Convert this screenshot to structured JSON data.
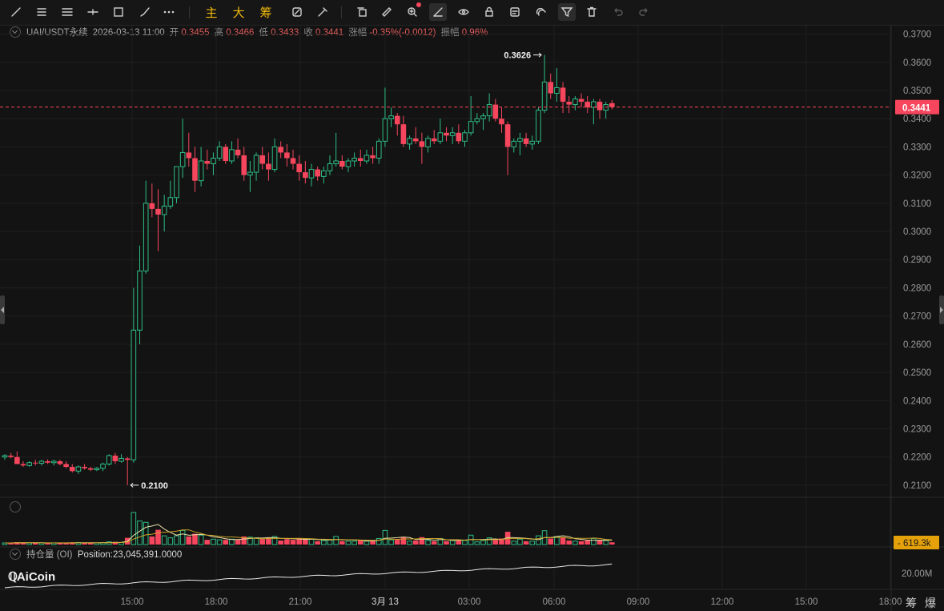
{
  "toolbar": {
    "text_buttons": [
      "主",
      "大",
      "筹"
    ],
    "icons": [
      "trend-line-icon",
      "parallel-lines-icon",
      "horizontal-lines-icon",
      "horizontal-ray-icon",
      "rectangle-icon",
      "brush-icon",
      "more-icon",
      "magnet-mode-icon",
      "pencil-edit-icon",
      "copy-icon",
      "ruler-icon",
      "zoom-icon",
      "draw-mode-icon",
      "hide-drawings-icon",
      "lock-icon",
      "drawing-template-icon",
      "magnet-icon",
      "filter-icon",
      "trash-icon",
      "undo-icon",
      "redo-icon"
    ]
  },
  "info": {
    "symbol": "UAI/USDT永续",
    "datetime": "2026-03-13 11:00",
    "open_label": "开",
    "open": "0.3455",
    "high_label": "高",
    "high": "0.3466",
    "low_label": "低",
    "low": "0.3433",
    "close_label": "收",
    "close": "0.3441",
    "change_label": "涨幅",
    "change": "-0.35%(-0.0012)",
    "amplitude_label": "振幅",
    "amplitude": "0.96%"
  },
  "price_axis": {
    "ticks": [
      "0.3700",
      "0.3600",
      "0.3500",
      "0.3400",
      "0.3300",
      "0.3200",
      "0.3100",
      "0.3000",
      "0.2900",
      "0.2800",
      "0.2700",
      "0.2600",
      "0.2500",
      "0.2400",
      "0.2300",
      "0.2200",
      "0.2100"
    ],
    "current_price": "0.3441",
    "max_marker": "0.3626",
    "min_marker": "0.2100"
  },
  "volume": {
    "last_label": "619.3k"
  },
  "open_interest": {
    "label": "持仓量 (OI)",
    "position": "Position:23,045,391.0000",
    "axis_label": "20.00M"
  },
  "time_axis": {
    "ticks": [
      "15:00",
      "18:00",
      "21:00",
      "3月 13",
      "03:00",
      "06:00",
      "09:00",
      "12:00",
      "15:00",
      "18:00"
    ]
  },
  "brand": {
    "name": "AiCoin"
  },
  "bottom_icons": [
    "筹",
    "爆"
  ],
  "colors": {
    "up": "#2ebd85",
    "down": "#f6465d",
    "accent": "#f0b90b"
  },
  "chart_data": {
    "type": "candlestick",
    "series": [
      {
        "name": "OHLC",
        "values": [
          [
            0.22,
            0.221,
            0.219,
            0.2205
          ],
          [
            0.2205,
            0.2215,
            0.2195,
            0.22
          ],
          [
            0.22,
            0.222,
            0.2185,
            0.2175
          ],
          [
            0.2175,
            0.2185,
            0.2165,
            0.217
          ],
          [
            0.217,
            0.2185,
            0.2165,
            0.218
          ],
          [
            0.218,
            0.219,
            0.217,
            0.2178
          ],
          [
            0.2178,
            0.219,
            0.217,
            0.2185
          ],
          [
            0.2185,
            0.2192,
            0.2175,
            0.218
          ],
          [
            0.218,
            0.219,
            0.217,
            0.2185
          ],
          [
            0.2185,
            0.219,
            0.217,
            0.2175
          ],
          [
            0.2175,
            0.2185,
            0.216,
            0.2165
          ],
          [
            0.2165,
            0.2175,
            0.2145,
            0.215
          ],
          [
            0.215,
            0.217,
            0.214,
            0.2165
          ],
          [
            0.2165,
            0.2175,
            0.2155,
            0.216
          ],
          [
            0.216,
            0.2165,
            0.215,
            0.2155
          ],
          [
            0.2155,
            0.2165,
            0.215,
            0.216
          ],
          [
            0.216,
            0.218,
            0.215,
            0.2175
          ],
          [
            0.2175,
            0.221,
            0.217,
            0.2205
          ],
          [
            0.2205,
            0.2215,
            0.2175,
            0.2185
          ],
          [
            0.2185,
            0.221,
            0.218,
            0.2195
          ],
          [
            0.2195,
            0.22,
            0.21,
            0.219
          ],
          [
            0.219,
            0.28,
            0.218,
            0.265
          ],
          [
            0.265,
            0.295,
            0.26,
            0.286
          ],
          [
            0.286,
            0.318,
            0.285,
            0.31
          ],
          [
            0.31,
            0.317,
            0.305,
            0.308
          ],
          [
            0.308,
            0.315,
            0.293,
            0.306
          ],
          [
            0.306,
            0.313,
            0.3,
            0.309
          ],
          [
            0.309,
            0.318,
            0.308,
            0.312
          ],
          [
            0.312,
            0.323,
            0.31,
            0.323
          ],
          [
            0.323,
            0.34,
            0.319,
            0.328
          ],
          [
            0.328,
            0.335,
            0.323,
            0.326
          ],
          [
            0.326,
            0.33,
            0.314,
            0.318
          ],
          [
            0.318,
            0.33,
            0.316,
            0.325
          ],
          [
            0.325,
            0.329,
            0.322,
            0.324
          ],
          [
            0.324,
            0.328,
            0.32,
            0.326
          ],
          [
            0.326,
            0.332,
            0.325,
            0.33
          ],
          [
            0.33,
            0.331,
            0.324,
            0.325
          ],
          [
            0.325,
            0.332,
            0.324,
            0.329
          ],
          [
            0.329,
            0.333,
            0.326,
            0.327
          ],
          [
            0.327,
            0.33,
            0.318,
            0.32
          ],
          [
            0.32,
            0.325,
            0.314,
            0.321
          ],
          [
            0.321,
            0.328,
            0.318,
            0.327
          ],
          [
            0.327,
            0.33,
            0.322,
            0.324
          ],
          [
            0.324,
            0.328,
            0.318,
            0.322
          ],
          [
            0.322,
            0.333,
            0.321,
            0.33
          ],
          [
            0.33,
            0.332,
            0.326,
            0.328
          ],
          [
            0.328,
            0.331,
            0.323,
            0.326
          ],
          [
            0.326,
            0.329,
            0.322,
            0.324
          ],
          [
            0.324,
            0.327,
            0.318,
            0.321
          ],
          [
            0.321,
            0.325,
            0.317,
            0.319
          ],
          [
            0.319,
            0.324,
            0.316,
            0.322
          ],
          [
            0.322,
            0.323,
            0.318,
            0.3195
          ],
          [
            0.3195,
            0.323,
            0.317,
            0.3215
          ],
          [
            0.3215,
            0.327,
            0.32,
            0.324
          ],
          [
            0.324,
            0.335,
            0.323,
            0.325
          ],
          [
            0.325,
            0.327,
            0.322,
            0.323
          ],
          [
            0.323,
            0.326,
            0.321,
            0.325
          ],
          [
            0.325,
            0.328,
            0.323,
            0.326
          ],
          [
            0.326,
            0.329,
            0.323,
            0.325
          ],
          [
            0.325,
            0.329,
            0.324,
            0.327
          ],
          [
            0.327,
            0.33,
            0.324,
            0.326
          ],
          [
            0.326,
            0.333,
            0.324,
            0.332
          ],
          [
            0.332,
            0.351,
            0.33,
            0.34
          ],
          [
            0.34,
            0.344,
            0.337,
            0.341
          ],
          [
            0.341,
            0.342,
            0.334,
            0.338
          ],
          [
            0.338,
            0.341,
            0.33,
            0.331
          ],
          [
            0.331,
            0.334,
            0.329,
            0.333
          ],
          [
            0.333,
            0.337,
            0.331,
            0.332
          ],
          [
            0.332,
            0.335,
            0.324,
            0.33
          ],
          [
            0.33,
            0.334,
            0.328,
            0.333
          ],
          [
            0.333,
            0.336,
            0.331,
            0.332
          ],
          [
            0.332,
            0.34,
            0.331,
            0.335
          ],
          [
            0.335,
            0.337,
            0.332,
            0.334
          ],
          [
            0.334,
            0.337,
            0.331,
            0.335
          ],
          [
            0.335,
            0.338,
            0.331,
            0.332
          ],
          [
            0.332,
            0.336,
            0.33,
            0.335
          ],
          [
            0.335,
            0.348,
            0.334,
            0.339
          ],
          [
            0.339,
            0.342,
            0.338,
            0.34
          ],
          [
            0.34,
            0.342,
            0.336,
            0.341
          ],
          [
            0.341,
            0.349,
            0.339,
            0.345
          ],
          [
            0.345,
            0.347,
            0.339,
            0.34
          ],
          [
            0.34,
            0.344,
            0.335,
            0.338
          ],
          [
            0.338,
            0.339,
            0.32,
            0.33
          ],
          [
            0.33,
            0.333,
            0.328,
            0.332
          ],
          [
            0.332,
            0.335,
            0.327,
            0.333
          ],
          [
            0.333,
            0.335,
            0.33,
            0.331
          ],
          [
            0.331,
            0.334,
            0.329,
            0.332
          ],
          [
            0.332,
            0.344,
            0.331,
            0.343
          ],
          [
            0.343,
            0.3626,
            0.342,
            0.353
          ],
          [
            0.353,
            0.356,
            0.347,
            0.349
          ],
          [
            0.349,
            0.358,
            0.346,
            0.351
          ],
          [
            0.351,
            0.353,
            0.342,
            0.346
          ],
          [
            0.346,
            0.348,
            0.342,
            0.345
          ],
          [
            0.345,
            0.348,
            0.343,
            0.347
          ],
          [
            0.347,
            0.349,
            0.344,
            0.346
          ],
          [
            0.346,
            0.348,
            0.342,
            0.344
          ],
          [
            0.344,
            0.347,
            0.338,
            0.346
          ],
          [
            0.346,
            0.347,
            0.34,
            0.343
          ],
          [
            0.343,
            0.346,
            0.34,
            0.345
          ],
          [
            0.3455,
            0.3466,
            0.3433,
            0.3441
          ]
        ]
      }
    ],
    "y_range": [
      0.206,
      0.373
    ],
    "grid": true
  }
}
